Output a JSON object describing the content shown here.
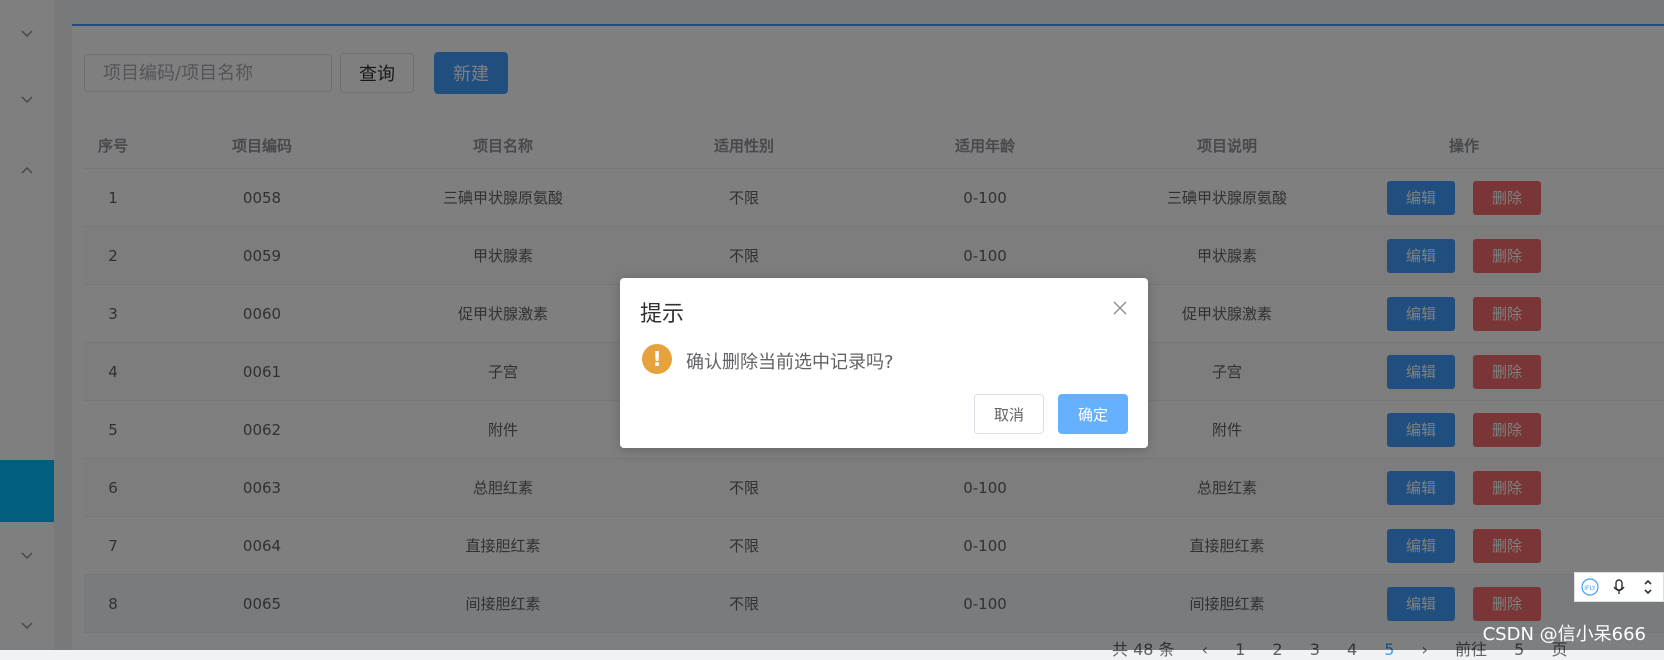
{
  "search": {
    "placeholder": "项目编码/项目名称"
  },
  "toolbar": {
    "query_label": "查询",
    "new_label": "新建"
  },
  "table": {
    "headers": [
      "序号",
      "项目编码",
      "项目名称",
      "适用性别",
      "适用年龄",
      "项目说明",
      "操作"
    ],
    "rows": [
      {
        "index": "1",
        "code": "0058",
        "name": "三碘甲状腺原氨酸",
        "gender": "不限",
        "age": "0-100",
        "desc": "三碘甲状腺原氨酸"
      },
      {
        "index": "2",
        "code": "0059",
        "name": "甲状腺素",
        "gender": "不限",
        "age": "0-100",
        "desc": "甲状腺素"
      },
      {
        "index": "3",
        "code": "0060",
        "name": "促甲状腺激素",
        "gender": "",
        "age": "",
        "desc": "促甲状腺激素"
      },
      {
        "index": "4",
        "code": "0061",
        "name": "子宫",
        "gender": "",
        "age": "",
        "desc": "子宫"
      },
      {
        "index": "5",
        "code": "0062",
        "name": "附件",
        "gender": "",
        "age": "",
        "desc": "附件"
      },
      {
        "index": "6",
        "code": "0063",
        "name": "总胆红素",
        "gender": "不限",
        "age": "0-100",
        "desc": "总胆红素"
      },
      {
        "index": "7",
        "code": "0064",
        "name": "直接胆红素",
        "gender": "不限",
        "age": "0-100",
        "desc": "直接胆红素"
      },
      {
        "index": "8",
        "code": "0065",
        "name": "间接胆红素",
        "gender": "不限",
        "age": "0-100",
        "desc": "间接胆红素"
      }
    ],
    "edit_label": "编辑",
    "delete_label": "删除"
  },
  "pagination": {
    "total": "共 48 条",
    "pages": [
      "1",
      "2",
      "3",
      "4",
      "5"
    ],
    "current": "5",
    "prev_text": "前往",
    "page_input": "5",
    "page_unit": "页"
  },
  "dialog": {
    "title": "提示",
    "message": "确认删除当前选中记录吗?",
    "cancel_label": "取消",
    "confirm_label": "确定",
    "icon": "warning-icon"
  },
  "watermark": "CSDN @信小呆666",
  "colors": {
    "primary": "#409eff",
    "danger": "#f56c6c",
    "warning": "#e6a23c",
    "sidebar_active": "#00bfff"
  }
}
